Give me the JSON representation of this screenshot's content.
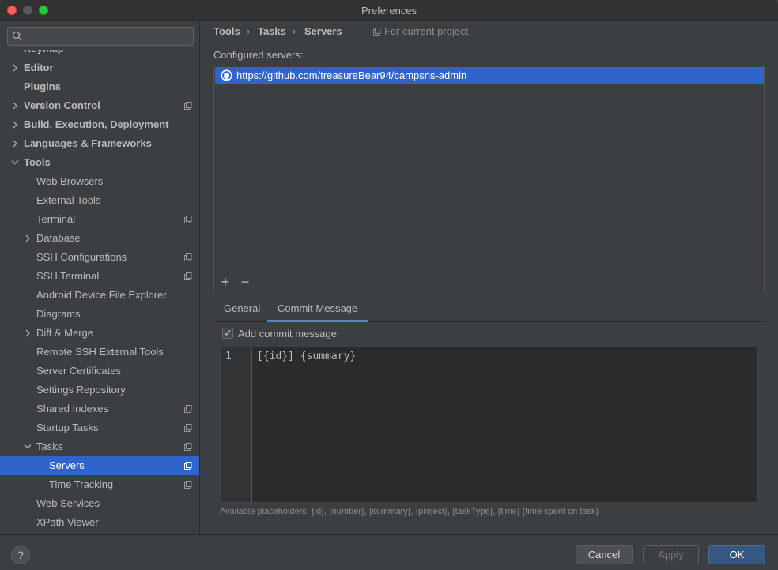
{
  "window": {
    "title": "Preferences"
  },
  "sidebar": {
    "search": {
      "placeholder": ""
    },
    "items": [
      {
        "label": "Keymap",
        "level": 0,
        "bold": true,
        "arrow": false,
        "project": false,
        "partial": true
      },
      {
        "label": "Editor",
        "level": 0,
        "bold": true,
        "arrow": "collapsed",
        "project": false
      },
      {
        "label": "Plugins",
        "level": 0,
        "bold": true,
        "arrow": false,
        "project": false
      },
      {
        "label": "Version Control",
        "level": 0,
        "bold": true,
        "arrow": "collapsed",
        "project": true
      },
      {
        "label": "Build, Execution, Deployment",
        "level": 0,
        "bold": true,
        "arrow": "collapsed",
        "project": false
      },
      {
        "label": "Languages & Frameworks",
        "level": 0,
        "bold": true,
        "arrow": "collapsed",
        "project": false
      },
      {
        "label": "Tools",
        "level": 0,
        "bold": true,
        "arrow": "expanded",
        "project": false
      },
      {
        "label": "Web Browsers",
        "level": 1,
        "bold": false,
        "arrow": false,
        "project": false
      },
      {
        "label": "External Tools",
        "level": 1,
        "bold": false,
        "arrow": false,
        "project": false
      },
      {
        "label": "Terminal",
        "level": 1,
        "bold": false,
        "arrow": false,
        "project": true
      },
      {
        "label": "Database",
        "level": 1,
        "bold": false,
        "arrow": "collapsed",
        "project": false
      },
      {
        "label": "SSH Configurations",
        "level": 1,
        "bold": false,
        "arrow": false,
        "project": true
      },
      {
        "label": "SSH Terminal",
        "level": 1,
        "bold": false,
        "arrow": false,
        "project": true
      },
      {
        "label": "Android Device File Explorer",
        "level": 1,
        "bold": false,
        "arrow": false,
        "project": false
      },
      {
        "label": "Diagrams",
        "level": 1,
        "bold": false,
        "arrow": false,
        "project": false
      },
      {
        "label": "Diff & Merge",
        "level": 1,
        "bold": false,
        "arrow": "collapsed",
        "project": false
      },
      {
        "label": "Remote SSH External Tools",
        "level": 1,
        "bold": false,
        "arrow": false,
        "project": false
      },
      {
        "label": "Server Certificates",
        "level": 1,
        "bold": false,
        "arrow": false,
        "project": false
      },
      {
        "label": "Settings Repository",
        "level": 1,
        "bold": false,
        "arrow": false,
        "project": false
      },
      {
        "label": "Shared Indexes",
        "level": 1,
        "bold": false,
        "arrow": false,
        "project": true
      },
      {
        "label": "Startup Tasks",
        "level": 1,
        "bold": false,
        "arrow": false,
        "project": true
      },
      {
        "label": "Tasks",
        "level": 1,
        "bold": false,
        "arrow": "expanded",
        "project": true
      },
      {
        "label": "Servers",
        "level": 2,
        "bold": false,
        "arrow": false,
        "project": true,
        "selected": true
      },
      {
        "label": "Time Tracking",
        "level": 2,
        "bold": false,
        "arrow": false,
        "project": true
      },
      {
        "label": "Web Services",
        "level": 1,
        "bold": false,
        "arrow": false,
        "project": false
      },
      {
        "label": "XPath Viewer",
        "level": 1,
        "bold": false,
        "arrow": false,
        "project": false
      }
    ]
  },
  "breadcrumb": {
    "items": [
      "Tools",
      "Tasks",
      "Servers"
    ],
    "separator": "›",
    "scope": "For current project"
  },
  "servers": {
    "label": "Configured servers:",
    "items": [
      {
        "url": "https://github.com/treasureBear94/campsns-admin",
        "icon": "github-icon"
      }
    ],
    "add_label": "+",
    "remove_label": "−"
  },
  "tabs": [
    {
      "label": "General",
      "active": false
    },
    {
      "label": "Commit Message",
      "active": true
    }
  ],
  "commit": {
    "checkbox_label": "Add commit message",
    "checked": true,
    "line_number": "1",
    "code": "[{id}] {summary}",
    "placeholders_hint": "Available placeholders: {id}, {number}, {summary}, {project}, {taskType}, {time} (time spent on task)"
  },
  "buttons": {
    "help": "?",
    "cancel": "Cancel",
    "apply": "Apply",
    "ok": "OK"
  },
  "colors": {
    "selection": "#2f65ca",
    "background": "#3c3f41",
    "editor": "#2b2b2b",
    "ok_button": "#365880"
  }
}
